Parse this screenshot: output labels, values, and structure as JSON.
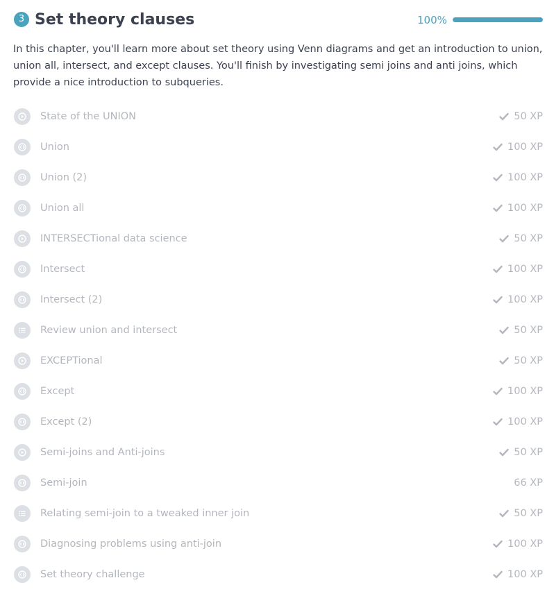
{
  "chapter": {
    "number": "3",
    "title": "Set theory clauses",
    "progress_label": "100%",
    "progress": 1.0,
    "description": "In this chapter, you'll learn more about set theory using Venn diagrams and get an introduction to union, union all, intersect, and except clauses. You'll finish by investigating semi joins and anti joins, which provide a nice introduction to subqueries."
  },
  "colors": {
    "accent": "#4aa3bd",
    "muted_text": "#b3b7bd",
    "icon_bg": "#dcdfe3"
  },
  "lessons": [
    {
      "title": "State of the UNION",
      "xp": "50 XP",
      "icon": "play-icon",
      "completed": true
    },
    {
      "title": "Union",
      "xp": "100 XP",
      "icon": "code-icon",
      "completed": true
    },
    {
      "title": "Union (2)",
      "xp": "100 XP",
      "icon": "code-icon",
      "completed": true
    },
    {
      "title": "Union all",
      "xp": "100 XP",
      "icon": "code-icon",
      "completed": true
    },
    {
      "title": "INTERSECTional data science",
      "xp": "50 XP",
      "icon": "play-icon",
      "completed": true
    },
    {
      "title": "Intersect",
      "xp": "100 XP",
      "icon": "code-icon",
      "completed": true
    },
    {
      "title": "Intersect (2)",
      "xp": "100 XP",
      "icon": "code-icon",
      "completed": true
    },
    {
      "title": "Review union and intersect",
      "xp": "50 XP",
      "icon": "list-icon",
      "completed": true
    },
    {
      "title": "EXCEPTional",
      "xp": "50 XP",
      "icon": "play-icon",
      "completed": true
    },
    {
      "title": "Except",
      "xp": "100 XP",
      "icon": "code-icon",
      "completed": true
    },
    {
      "title": "Except (2)",
      "xp": "100 XP",
      "icon": "code-icon",
      "completed": true
    },
    {
      "title": "Semi-joins and Anti-joins",
      "xp": "50 XP",
      "icon": "play-icon",
      "completed": true
    },
    {
      "title": "Semi-join",
      "xp": "66 XP",
      "icon": "code-icon",
      "completed": false
    },
    {
      "title": "Relating semi-join to a tweaked inner join",
      "xp": "50 XP",
      "icon": "list-icon",
      "completed": true
    },
    {
      "title": "Diagnosing problems using anti-join",
      "xp": "100 XP",
      "icon": "code-icon",
      "completed": true
    },
    {
      "title": "Set theory challenge",
      "xp": "100 XP",
      "icon": "code-icon",
      "completed": true
    }
  ]
}
